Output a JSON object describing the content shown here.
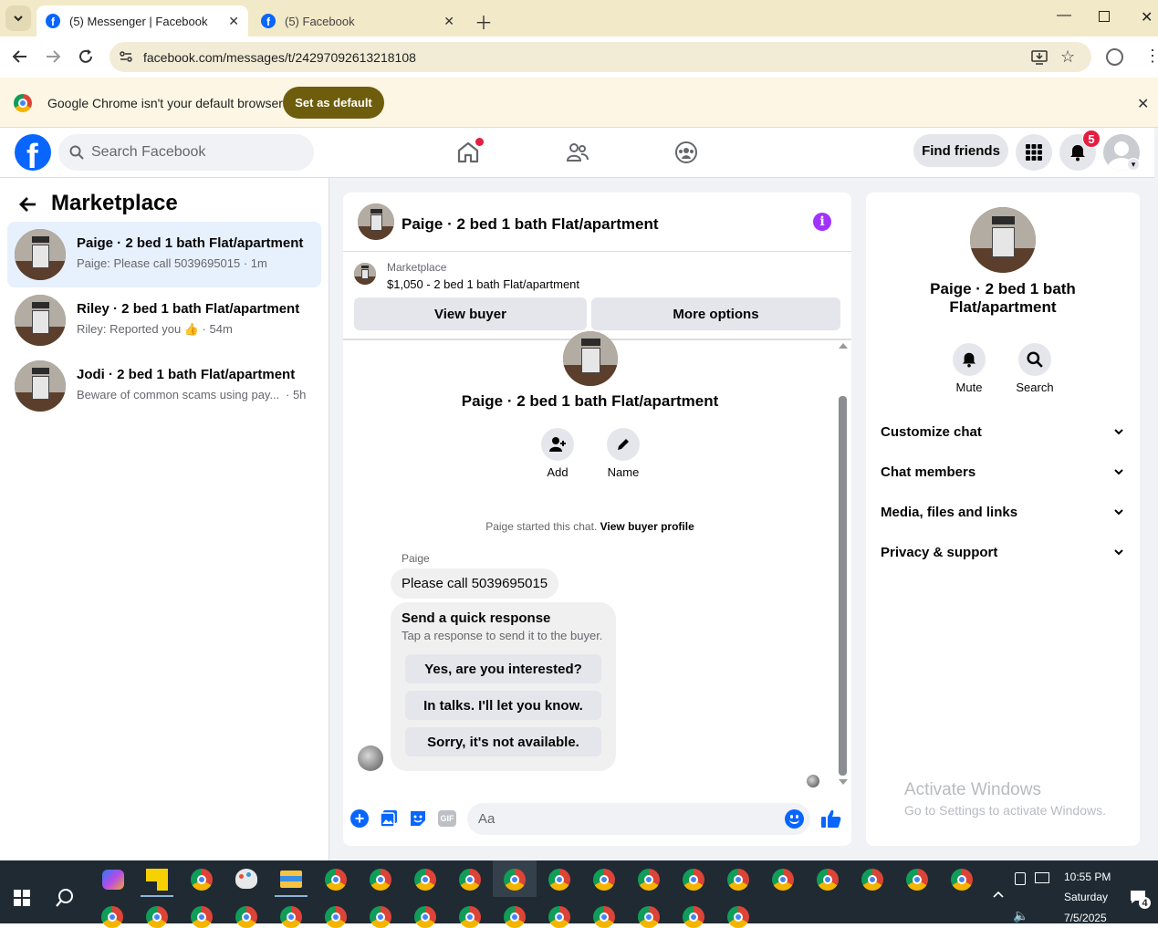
{
  "browser": {
    "tabs": [
      {
        "title": "(5) Messenger | Facebook",
        "active": true
      },
      {
        "title": "(5) Facebook",
        "active": false
      }
    ],
    "url": "facebook.com/messages/t/24297092613218108",
    "infobar_text": "Google Chrome isn't your default browser",
    "set_default_label": "Set as default"
  },
  "fb_header": {
    "search_placeholder": "Search Facebook",
    "find_friends_label": "Find friends",
    "notification_count": "5"
  },
  "left_panel": {
    "title": "Marketplace",
    "conversations": [
      {
        "title": "Paige · 2 bed 1 bath Flat/apartment",
        "subtitle": "Paige: Please call 5039695015 · 1m",
        "active": true
      },
      {
        "title": "Riley · 2 bed 1 bath Flat/apartment",
        "subtitle": "Riley: Reported you 👍 · 54m",
        "active": false
      },
      {
        "title": "Jodi · 2 bed 1 bath Flat/apartment",
        "subtitle": "Beware of common scams using pay...",
        "time": "· 5h",
        "active": false
      }
    ]
  },
  "chat": {
    "header_title": "Paige · 2 bed 1 bath Flat/apartment",
    "listing_source": "Marketplace",
    "listing_line": "$1,050 - 2 bed 1 bath Flat/apartment",
    "view_buyer_label": "View buyer",
    "more_options_label": "More options",
    "profile_name": "Paige · 2 bed 1 bath Flat/apartment",
    "add_label": "Add",
    "name_label": "Name",
    "started_text": "Paige started this chat.",
    "view_buyer_profile_label": "View buyer profile",
    "sender_name": "Paige",
    "message_text": "Please call 5039695015",
    "quick_response_title": "Send a quick response",
    "quick_response_sub": "Tap a response to send it to the buyer.",
    "quick_responses": [
      "Yes, are you interested?",
      "In talks. I'll let you know.",
      "Sorry, it's not available."
    ],
    "composer_placeholder": "Aa"
  },
  "right_panel": {
    "name": "Paige · 2 bed 1 bath Flat/apartment",
    "mute_label": "Mute",
    "search_label": "Search",
    "rows": [
      "Customize chat",
      "Chat members",
      "Media, files and links",
      "Privacy & support"
    ]
  },
  "watermark": {
    "line1": "Activate Windows",
    "line2": "Go to Settings to activate Windows."
  },
  "taskbar": {
    "time": "10:55 PM",
    "day": "Saturday",
    "date": "7/5/2025",
    "notification_count": "4"
  },
  "colors": {
    "facebook_blue": "#0866ff",
    "messenger_accent": "#0866ff",
    "info_purple": "#a033ff",
    "badge_red": "#e41e3f"
  }
}
